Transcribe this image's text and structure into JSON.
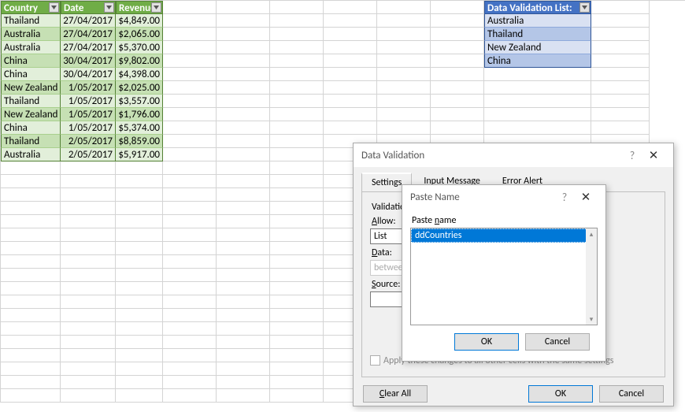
{
  "main_table": {
    "headers": [
      "Country",
      "Date",
      "Revenue"
    ],
    "rows": [
      {
        "country": "Thailand",
        "date": "27/04/2017",
        "rev": "$4,849.00"
      },
      {
        "country": "Australia",
        "date": "27/04/2017",
        "rev": "$2,065.00"
      },
      {
        "country": "Australia",
        "date": "27/04/2017",
        "rev": "$5,370.00"
      },
      {
        "country": "China",
        "date": "30/04/2017",
        "rev": "$9,802.00"
      },
      {
        "country": "China",
        "date": "30/04/2017",
        "rev": "$4,398.00"
      },
      {
        "country": "New Zealand",
        "date": "1/05/2017",
        "rev": "$2,025.00"
      },
      {
        "country": "Thailand",
        "date": "1/05/2017",
        "rev": "$3,557.00"
      },
      {
        "country": "New Zealand",
        "date": "1/05/2017",
        "rev": "$1,796.00"
      },
      {
        "country": "China",
        "date": "1/05/2017",
        "rev": "$5,374.00"
      },
      {
        "country": "Thailand",
        "date": "2/05/2017",
        "rev": "$8,859.00"
      },
      {
        "country": "Australia",
        "date": "2/05/2017",
        "rev": "$5,917.00"
      }
    ]
  },
  "val_list": {
    "header": "Data Validation List:",
    "items": [
      "Australia",
      "Thailand",
      "New Zealand",
      "China"
    ]
  },
  "dv_dialog": {
    "title": "Data Validation",
    "tabs": {
      "settings": "Settings",
      "input": "Input Message",
      "error": "Error Alert"
    },
    "criteria_label": "Validation criteria",
    "allow_label": "Allow:",
    "allow_value": "List",
    "data_label": "Data:",
    "data_value": "between",
    "source_label": "Source:",
    "source_value": "",
    "apply_label": "Apply these changes to all other cells with the same settings",
    "clear_all": "Clear All",
    "ok": "OK",
    "cancel": "Cancel"
  },
  "pn_dialog": {
    "title": "Paste Name",
    "label": "Paste name",
    "items": [
      "ddCountries"
    ],
    "ok": "OK",
    "cancel": "Cancel"
  }
}
